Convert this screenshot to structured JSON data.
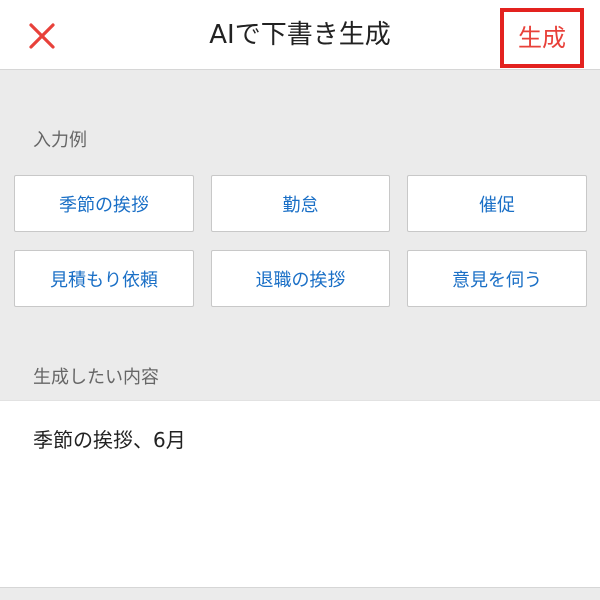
{
  "header": {
    "title": "AIで下書き生成",
    "close_icon": "close-icon",
    "generate_label": "生成",
    "close_color": "#e8413a",
    "generate_color": "#e8413a",
    "highlight_color": "#e3221f"
  },
  "examples": {
    "label": "入力例",
    "items": [
      {
        "label": "季節の挨拶"
      },
      {
        "label": "勤怠"
      },
      {
        "label": "催促"
      },
      {
        "label": "見積もり依頼"
      },
      {
        "label": "退職の挨拶"
      },
      {
        "label": "意見を伺う"
      }
    ],
    "link_color": "#1a6fc6"
  },
  "content": {
    "label": "生成したい内容",
    "value": "季節の挨拶、6月"
  }
}
